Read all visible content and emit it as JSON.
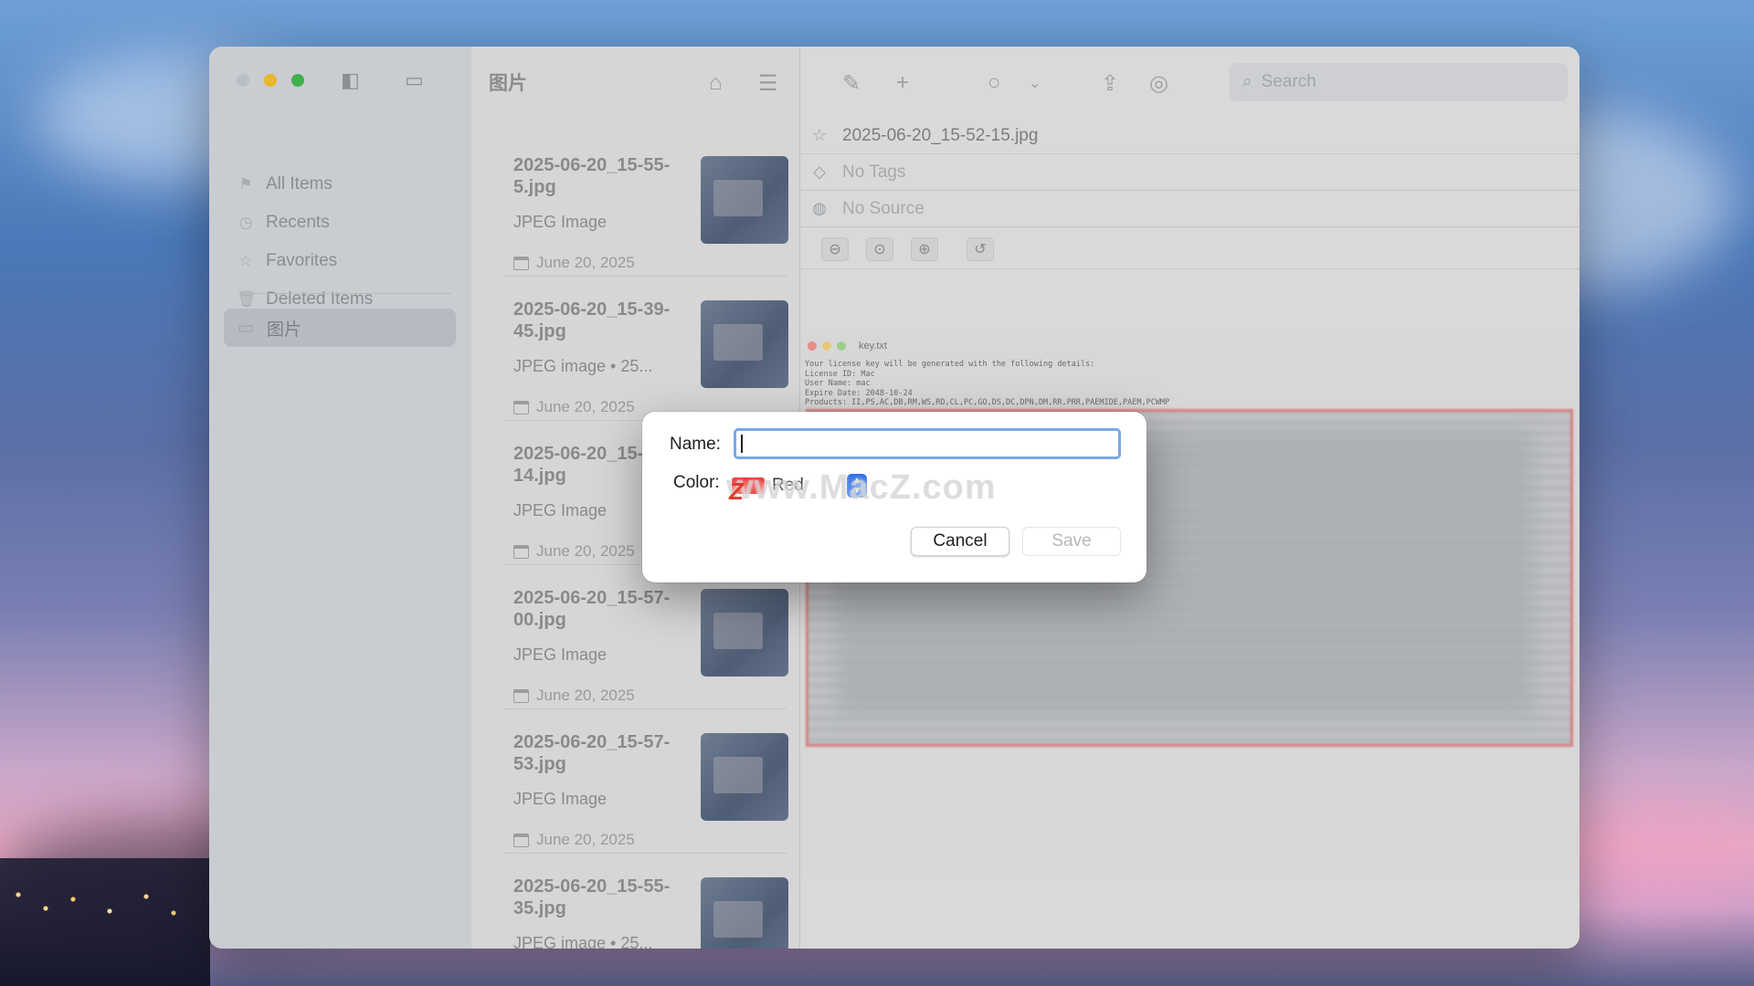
{
  "window": {
    "list_title": "图片",
    "search_placeholder": "Search"
  },
  "sidebar": {
    "items": [
      {
        "label": "All Items",
        "icon": "all-items-icon"
      },
      {
        "label": "Recents",
        "icon": "clock-icon"
      },
      {
        "label": "Favorites",
        "icon": "star-icon"
      },
      {
        "label": "Deleted Items",
        "icon": "trash-icon"
      }
    ],
    "folder": {
      "label": "图片",
      "icon": "folder-icon"
    }
  },
  "list": {
    "items": [
      {
        "name": "2025-06-20_15-55-5.jpg",
        "type": "JPEG Image",
        "date": "June 20, 2025"
      },
      {
        "name": "2025-06-20_15-39-45.jpg",
        "type": "JPEG image • 25...",
        "date": "June 20, 2025"
      },
      {
        "name": "2025-06-20_15-55-14.jpg",
        "type": "JPEG Image",
        "date": "June 20, 2025"
      },
      {
        "name": "2025-06-20_15-57-00.jpg",
        "type": "JPEG Image",
        "date": "June 20, 2025"
      },
      {
        "name": "2025-06-20_15-57-53.jpg",
        "type": "JPEG Image",
        "date": "June 20, 2025"
      },
      {
        "name": "2025-06-20_15-55-35.jpg",
        "type": "JPEG image • 25...",
        "date": ""
      }
    ]
  },
  "detail": {
    "filename": "2025-06-20_15-52-15.jpg",
    "tags": "No Tags",
    "source": "No Source",
    "preview": {
      "window_title": "key.txt",
      "lines": [
        "Your license key will be generated with the following details:",
        "License ID: Mac",
        "User Name: mac",
        "Expire Date: 2048-10-24",
        "Products: II,PS,AC,DB,RM,WS,RD,CL,PC,GO,DS,DC,DPN,DM,RR,PRR,PAEMIDE,PAEM,PCWMP"
      ]
    }
  },
  "dialog": {
    "name_label": "Name:",
    "name_value": "",
    "color_label": "Color:",
    "color_value": "Red",
    "color_hex": "#e6322f",
    "cancel_label": "Cancel",
    "save_label": "Save",
    "watermark": "www.MacZ.com",
    "watermark_logo": "Z"
  }
}
